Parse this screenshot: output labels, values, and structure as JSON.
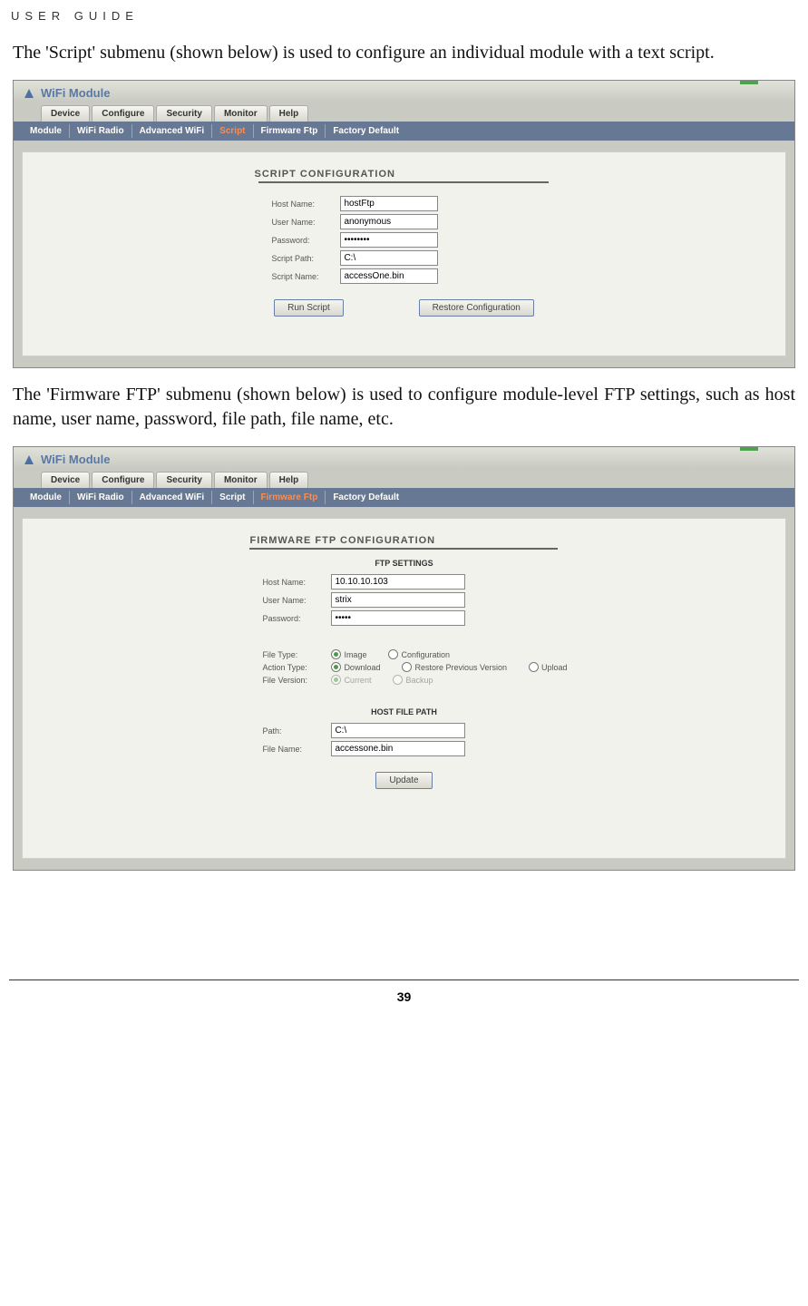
{
  "header": "USER GUIDE",
  "intro1": "The 'Script' submenu (shown below) is used to configure an individual module with a text script.",
  "intro2": "The 'Firmware FTP' submenu (shown below) is used to configure module-level FTP settings, such as host name, user name, password, file path, file name, etc.",
  "footer_page": "39",
  "app": {
    "title": "WiFi Module",
    "tabs": [
      "Device",
      "Configure",
      "Security",
      "Monitor",
      "Help"
    ],
    "sub_tabs": [
      "Module",
      "WiFi Radio",
      "Advanced WiFi",
      "Script",
      "Firmware Ftp",
      "Factory Default"
    ]
  },
  "script_panel": {
    "title": "SCRIPT CONFIGURATION",
    "host_name_label": "Host Name:",
    "host_name_value": "hostFtp",
    "user_name_label": "User Name:",
    "user_name_value": "anonymous",
    "password_label": "Password:",
    "password_value": "••••••••",
    "script_path_label": "Script Path:",
    "script_path_value": "C:\\",
    "script_name_label": "Script Name:",
    "script_name_value": "accessOne.bin",
    "run_btn": "Run Script",
    "restore_btn": "Restore Configuration"
  },
  "ftp_panel": {
    "title": "FIRMWARE FTP CONFIGURATION",
    "ftp_settings_header": "FTP SETTINGS",
    "host_name_label": "Host Name:",
    "host_name_value": "10.10.10.103",
    "user_name_label": "User Name:",
    "user_name_value": "strix",
    "password_label": "Password:",
    "password_value": "•••••",
    "file_type_label": "File Type:",
    "file_type_options": [
      "Image",
      "Configuration"
    ],
    "action_type_label": "Action Type:",
    "action_type_options": [
      "Download",
      "Restore Previous Version",
      "Upload"
    ],
    "file_version_label": "File Version:",
    "file_version_options": [
      "Current",
      "Backup"
    ],
    "host_file_path_header": "HOST FILE PATH",
    "path_label": "Path:",
    "path_value": "C:\\",
    "file_name_label": "File Name:",
    "file_name_value": "accessone.bin",
    "update_btn": "Update"
  }
}
